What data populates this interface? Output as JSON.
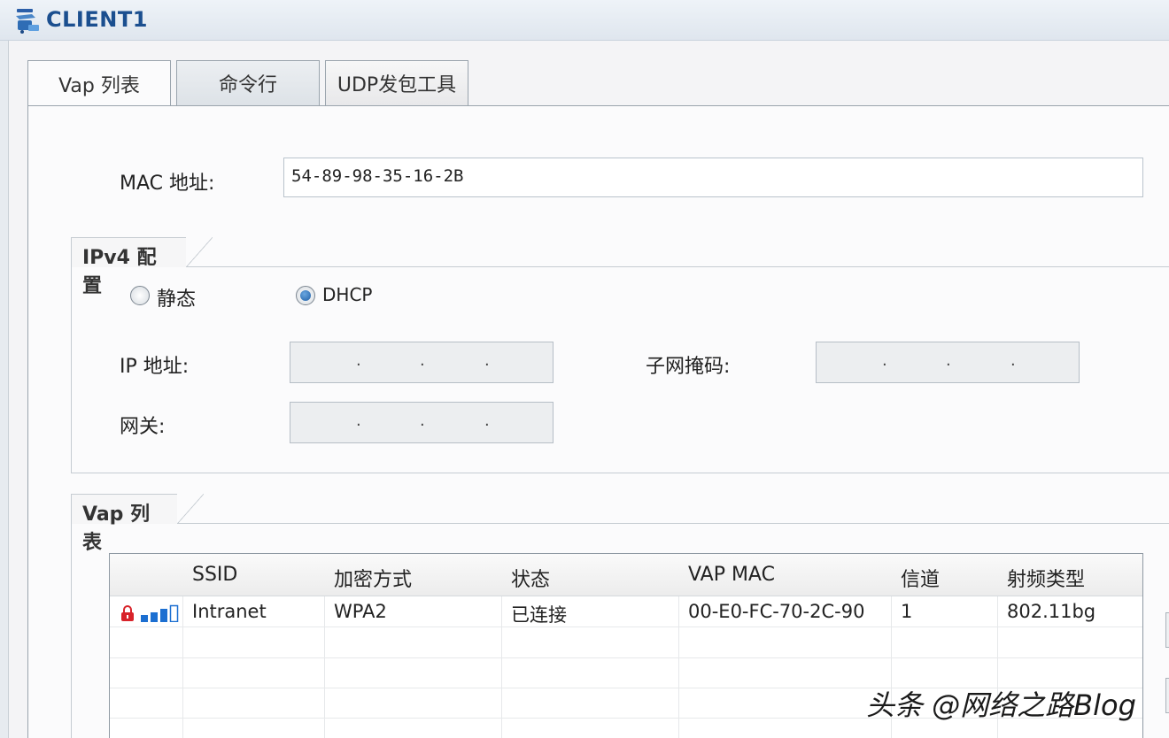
{
  "window": {
    "title": "CLIENT1"
  },
  "tabs": [
    {
      "label": "Vap 列表",
      "active": true
    },
    {
      "label": "命令行",
      "active": false
    },
    {
      "label": "UDP发包工具",
      "active": false
    }
  ],
  "mac": {
    "label": "MAC 地址:",
    "value": "54-89-98-35-16-2B"
  },
  "ipv4": {
    "group_title": "IPv4 配置",
    "mode_static_label": "静态",
    "mode_dhcp_label": "DHCP",
    "selected_mode": "DHCP",
    "ip_label": "IP 地址:",
    "mask_label": "子网掩码:",
    "gateway_label": "网关:",
    "dot": "."
  },
  "vap": {
    "group_title": "Vap 列表",
    "columns": [
      "",
      "SSID",
      "加密方式",
      "状态",
      "VAP MAC",
      "信道",
      "射频类型"
    ],
    "rows": [
      {
        "ssid": "Intranet",
        "encryption": "WPA2",
        "status": "已连接",
        "vap_mac": "00-E0-FC-70-2C-90",
        "channel": "1",
        "radio_type": "802.11bg",
        "icons": [
          "lock-icon",
          "signal-strength-icon"
        ]
      }
    ],
    "signal_bars_filled": 3
  },
  "watermark": "头条 @网络之路Blog",
  "colors": {
    "title": "#1b4f8f",
    "lock": "#d8232a",
    "signal": "#1c6fd1"
  }
}
